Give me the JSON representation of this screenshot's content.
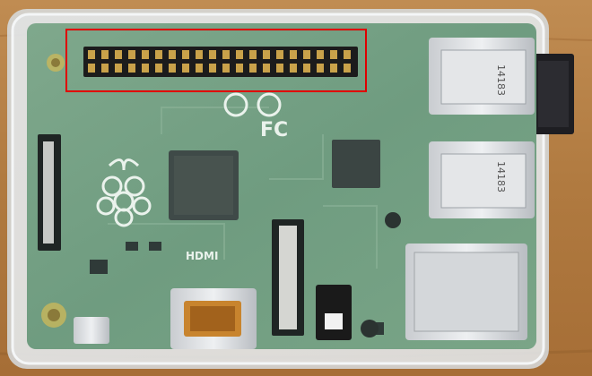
{
  "scene": {
    "description_free": true,
    "board_text": {
      "hdmi": "HDMI",
      "usb_label_top": "14183",
      "usb_label_bottom": "14183"
    },
    "highlight_color": "#e00000",
    "pin_rows": 2,
    "pins_per_row": 20
  }
}
